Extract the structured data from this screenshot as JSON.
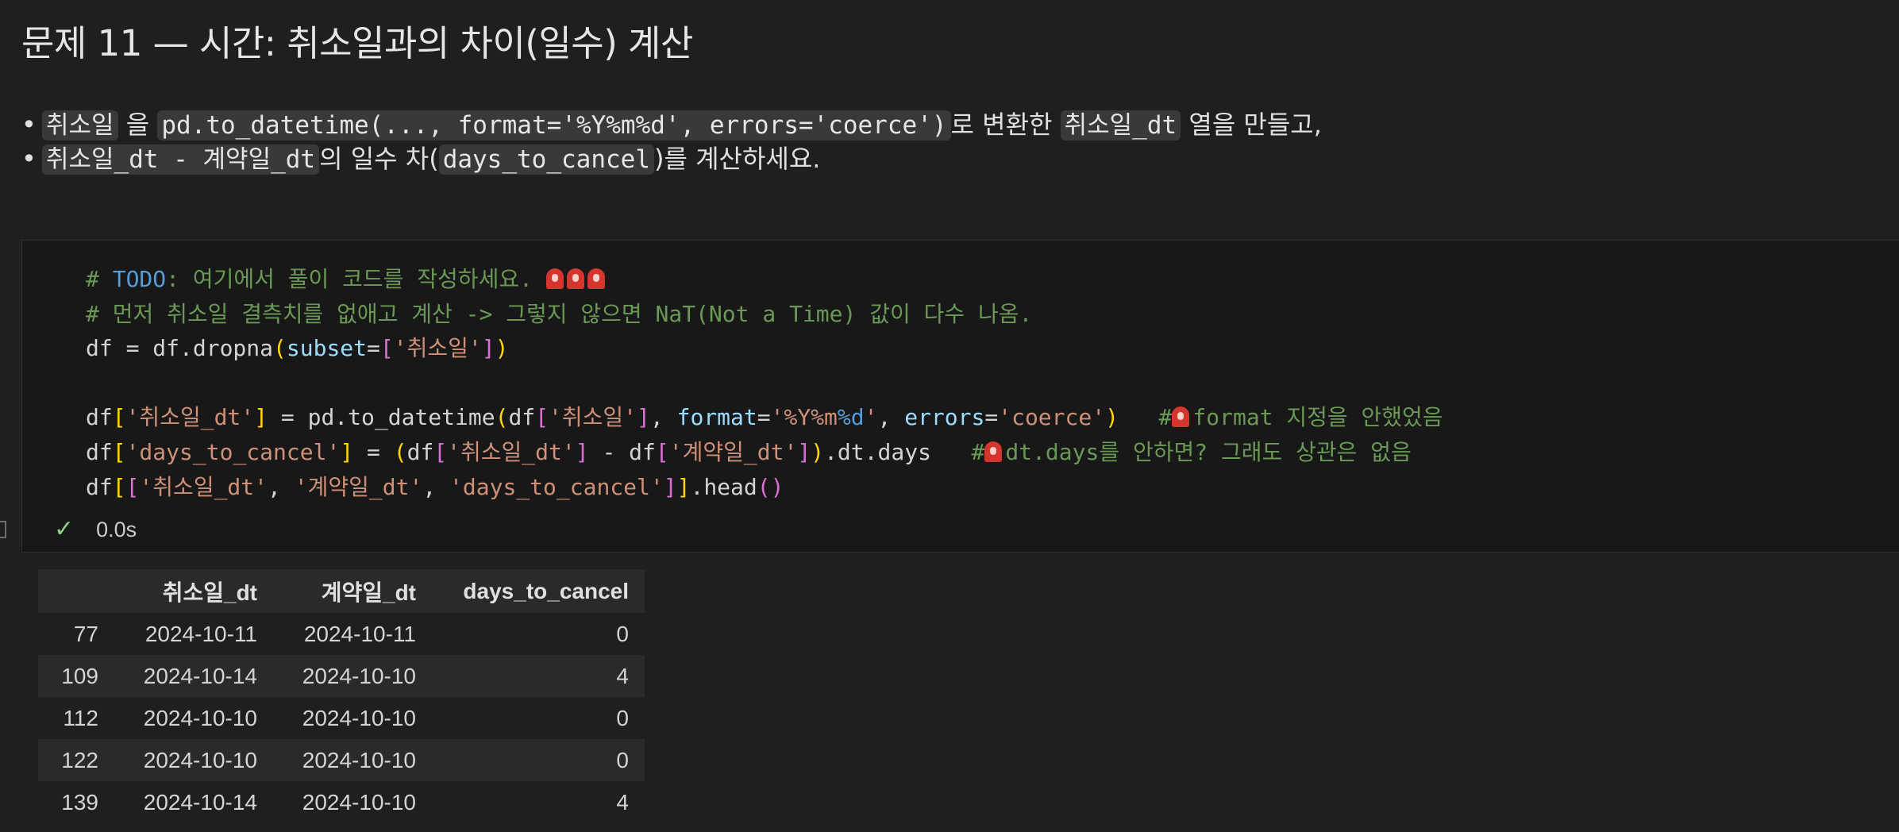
{
  "markdown": {
    "title": "문제 11 — 시간: 취소일과의 차이(일수) 계산",
    "bullet_char": "•",
    "line1": {
      "code1": "취소일",
      "text1": "을",
      "code2": "pd.to_datetime(..., format='%Y%m%d', errors='coerce')",
      "text2": "로 변환한",
      "code3": "취소일_dt",
      "text3": "열을 만들고,"
    },
    "line2": {
      "code1": "취소일_dt - 계약일_dt",
      "text1": "의 일수 차(",
      "code2": "days_to_cancel",
      "text2": ")를 계산하세요."
    }
  },
  "code_cell": {
    "status_icon": "check-icon",
    "exec_time": "0.0s",
    "icons": [
      "siren-icon"
    ],
    "colors": {
      "comment": "#6a9955",
      "keyword": "#569cd6",
      "string": "#ce9178",
      "param": "#9cdcfe"
    }
  },
  "output_table": {
    "columns": [
      "",
      "취소일_dt",
      "계약일_dt",
      "days_to_cancel"
    ],
    "rows": [
      {
        "index": "77",
        "cancel": "2024-10-11",
        "contract": "2024-10-11",
        "days": "0"
      },
      {
        "index": "109",
        "cancel": "2024-10-14",
        "contract": "2024-10-10",
        "days": "4"
      },
      {
        "index": "112",
        "cancel": "2024-10-10",
        "contract": "2024-10-10",
        "days": "0"
      },
      {
        "index": "122",
        "cancel": "2024-10-10",
        "contract": "2024-10-10",
        "days": "0"
      },
      {
        "index": "139",
        "cancel": "2024-10-14",
        "contract": "2024-10-10",
        "days": "4"
      }
    ]
  }
}
